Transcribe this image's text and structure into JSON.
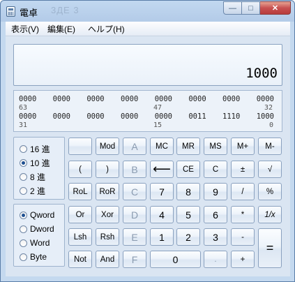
{
  "window": {
    "title": "電卓",
    "ghost_title": "3ДE 3"
  },
  "caption": {
    "min": "—",
    "max": "□",
    "close": "✕"
  },
  "menu": [
    "表示(V)",
    "編集(E)",
    "ヘルプ(H)"
  ],
  "display": {
    "value": "1000"
  },
  "bits": {
    "row1": [
      "0000",
      "0000",
      "0000",
      "0000",
      "0000",
      "0000",
      "0000",
      "0000"
    ],
    "row1_idx": [
      "63",
      "47",
      "32"
    ],
    "row2": [
      "0000",
      "0000",
      "0000",
      "0000",
      "0000",
      "0011",
      "1110",
      "1000"
    ],
    "row2_idx": [
      "31",
      "15",
      "0"
    ]
  },
  "base_radios": [
    {
      "label": "16 進",
      "checked": false
    },
    {
      "label": "10 進",
      "checked": true
    },
    {
      "label": "8 進",
      "checked": false
    },
    {
      "label": "2 進",
      "checked": false
    }
  ],
  "word_radios": [
    {
      "label": "Qword",
      "checked": true
    },
    {
      "label": "Dword",
      "checked": false
    },
    {
      "label": "Word",
      "checked": false
    },
    {
      "label": "Byte",
      "checked": false
    }
  ],
  "keys": {
    "blank": "",
    "mod": "Mod",
    "a": "A",
    "mc": "MC",
    "mr": "MR",
    "ms": "MS",
    "mplus": "M+",
    "mminus": "M-",
    "lparen": "(",
    "rparen": ")",
    "b": "B",
    "back": "⟵",
    "ce": "CE",
    "c": "C",
    "pm": "±",
    "sqrt": "√",
    "rol": "RoL",
    "ror": "RoR",
    "cc": "C",
    "n7": "7",
    "n8": "8",
    "n9": "9",
    "div": "/",
    "pct": "%",
    "or": "Or",
    "xor": "Xor",
    "d": "D",
    "n4": "4",
    "n5": "5",
    "n6": "6",
    "mul": "*",
    "recip": "1/x",
    "lsh": "Lsh",
    "rsh": "Rsh",
    "e": "E",
    "n1": "1",
    "n2": "2",
    "n3": "3",
    "sub": "-",
    "eq": "=",
    "not": "Not",
    "and": "And",
    "f": "F",
    "n0": "0",
    "dot": ".",
    "add": "+"
  },
  "colors": {
    "accent": "#1d4f91",
    "panel": "#dae5f2",
    "close": "#c75050"
  }
}
